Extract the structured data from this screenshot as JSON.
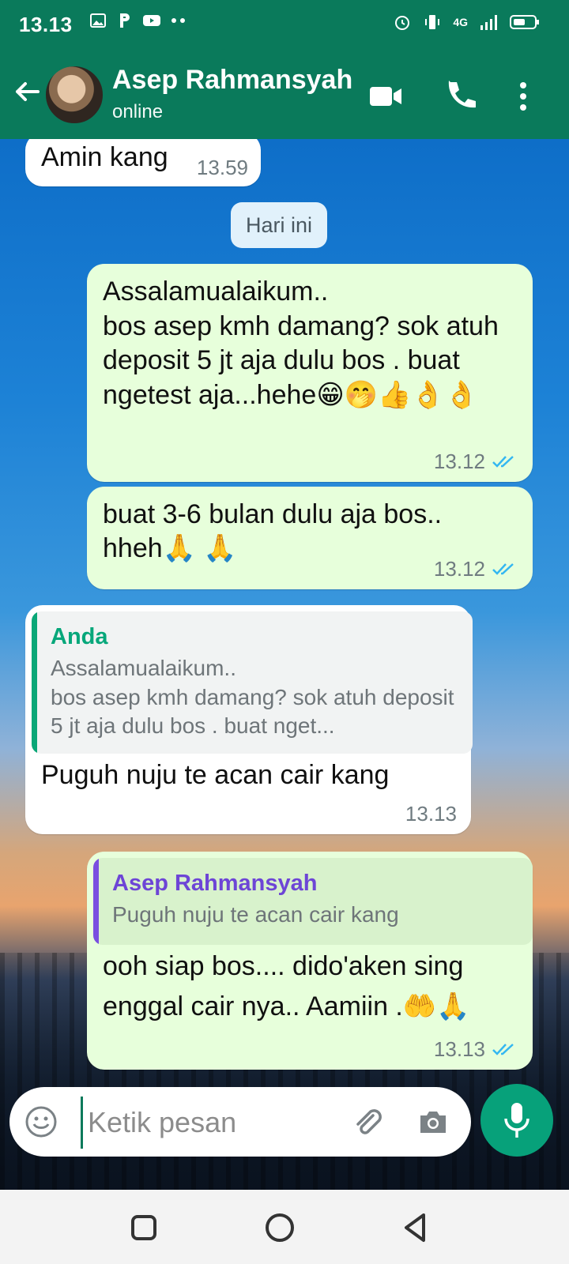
{
  "status_bar": {
    "time": "13.13",
    "network_label": "4G"
  },
  "header": {
    "name": "Asep Rahmansyah",
    "status": "online"
  },
  "messages": [
    {
      "text": "Amin kang",
      "time": "13.59"
    },
    {
      "date_pill": "Hari ini"
    },
    {
      "text": "Assalamualaikum..\nbos asep kmh damang? sok atuh deposit 5 jt aja dulu bos . buat ngetest aja...hehe😁🤭👍👌👌",
      "time": "13.12"
    },
    {
      "text": "buat 3-6 bulan dulu aja bos.. hheh🙏 🙏",
      "time": "13.12"
    },
    {
      "reply_name": "Anda",
      "reply_text": "Assalamualaikum..\nbos asep kmh damang? sok atuh deposit 5 jt aja dulu bos . buat nget...",
      "text": "Puguh nuju te acan cair kang",
      "time": "13.13"
    },
    {
      "reply_name": "Asep Rahmansyah",
      "reply_text": "Puguh nuju te acan cair kang",
      "text": "ooh siap bos.... dido'aken sing enggal cair nya.. Aamiin .🤲🙏",
      "time": "13.13"
    }
  ],
  "input": {
    "placeholder": "Ketik pesan"
  },
  "colors": {
    "header": "#0a7a5b",
    "outgoing_bubble": "#e7ffdb",
    "incoming_bubble": "#ffffff",
    "read_ticks": "#34b7f1",
    "mic_button": "#07a17a"
  }
}
